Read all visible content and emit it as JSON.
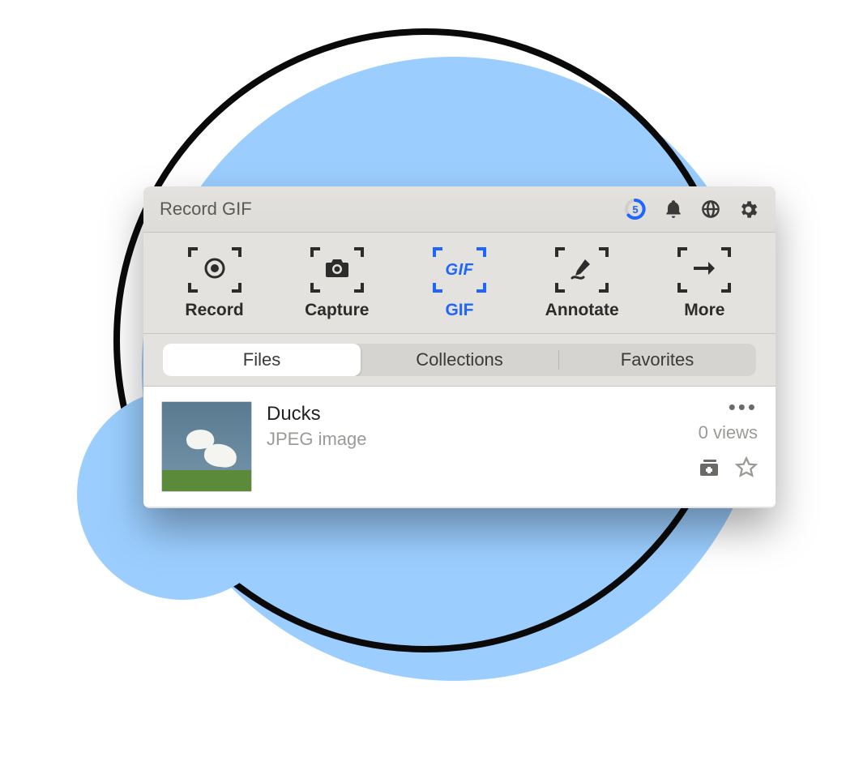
{
  "header": {
    "title": "Record GIF",
    "countdown_value": "5"
  },
  "toolbar": {
    "items": [
      {
        "label": "Record",
        "active": false
      },
      {
        "label": "Capture",
        "active": false
      },
      {
        "label": "GIF",
        "active": true
      },
      {
        "label": "Annotate",
        "active": false
      },
      {
        "label": "More",
        "active": false
      }
    ]
  },
  "tabs": {
    "items": [
      {
        "label": "Files",
        "active": true
      },
      {
        "label": "Collections",
        "active": false
      },
      {
        "label": "Favorites",
        "active": false
      }
    ]
  },
  "files": [
    {
      "name": "Ducks",
      "type": "JPEG image",
      "views_text": "0 views"
    }
  ]
}
